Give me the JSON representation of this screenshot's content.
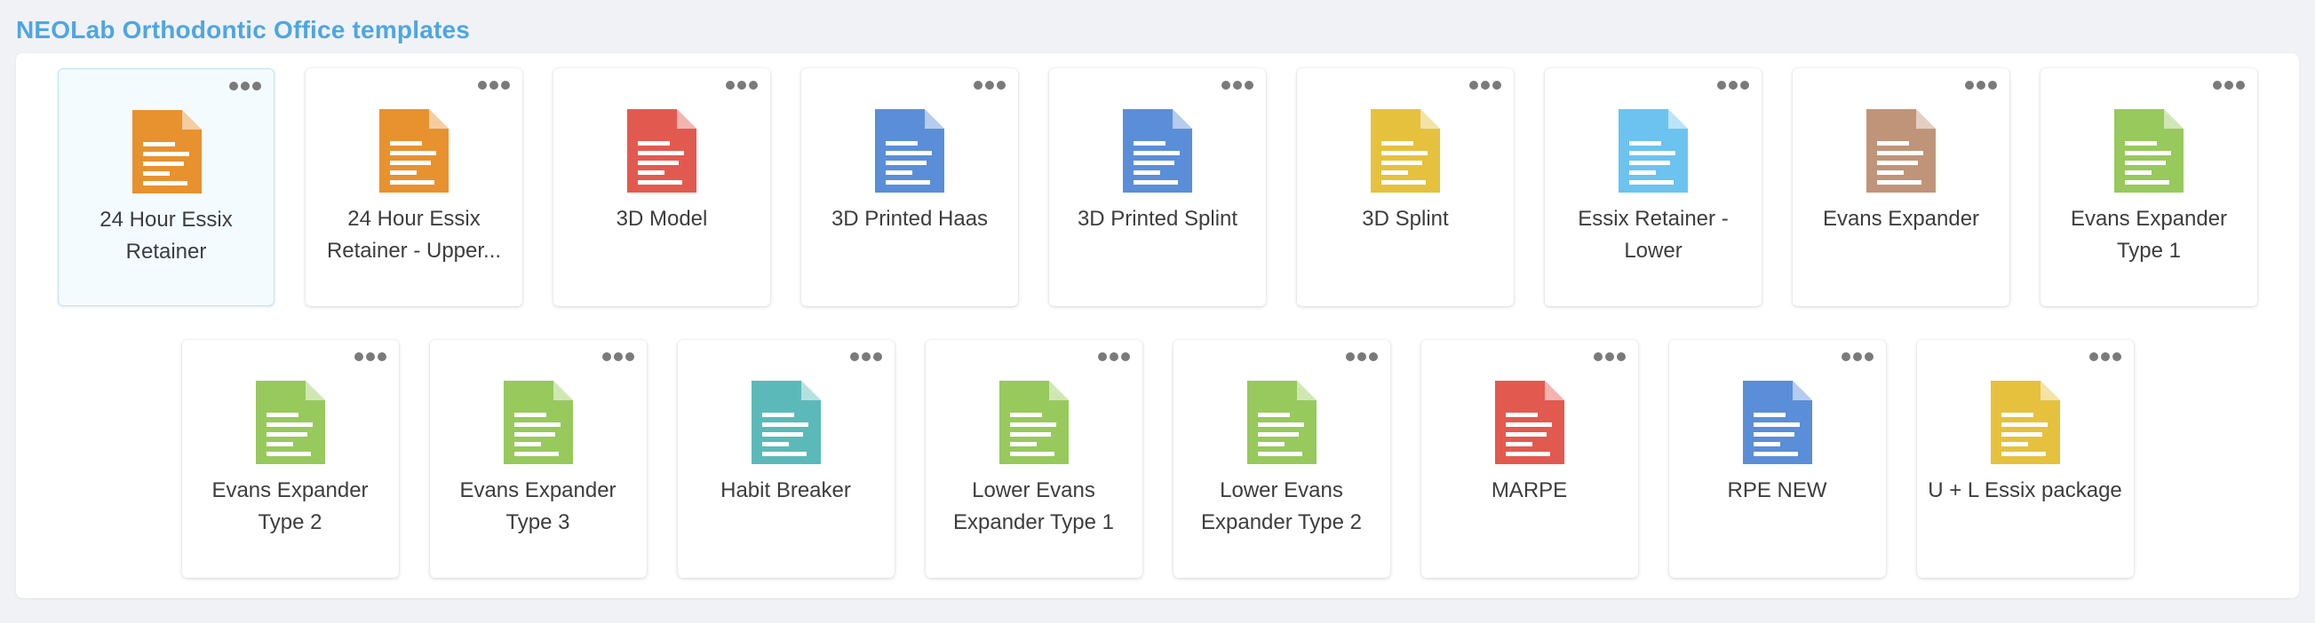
{
  "header": {
    "title": "NEOLab Orthodontic Office templates"
  },
  "colors": {
    "title": "#4da6e3",
    "orange": "#e8912f",
    "red": "#e25a4f",
    "blue": "#5b8ed8",
    "yellow": "#e6c13e",
    "light_blue": "#6cc3ef",
    "brown": "#c09479",
    "green": "#97c95c",
    "teal": "#5bbab9"
  },
  "templates": [
    {
      "label": "24 Hour Essix Retainer",
      "color": "#e8912f",
      "icon": "document-icon",
      "selected": true
    },
    {
      "label": "24 Hour Essix Retainer - Upper...",
      "color": "#e8912f",
      "icon": "document-icon"
    },
    {
      "label": "3D Model",
      "color": "#e25a4f",
      "icon": "document-icon"
    },
    {
      "label": "3D Printed Haas",
      "color": "#5b8ed8",
      "icon": "document-icon"
    },
    {
      "label": "3D Printed Splint",
      "color": "#5b8ed8",
      "icon": "document-icon"
    },
    {
      "label": "3D Splint",
      "color": "#e6c13e",
      "icon": "document-icon"
    },
    {
      "label": "Essix Retainer - Lower",
      "color": "#6cc3ef",
      "icon": "document-icon"
    },
    {
      "label": "Evans Expander",
      "color": "#c09479",
      "icon": "document-icon"
    },
    {
      "label": "Evans Expander Type 1",
      "color": "#97c95c",
      "icon": "document-icon"
    },
    {
      "label": "Evans Expander Type 2",
      "color": "#97c95c",
      "icon": "document-icon"
    },
    {
      "label": "Evans Expander Type 3",
      "color": "#97c95c",
      "icon": "document-icon"
    },
    {
      "label": "Habit Breaker",
      "color": "#5bbab9",
      "icon": "document-icon"
    },
    {
      "label": "Lower Evans Expander Type 1",
      "color": "#97c95c",
      "icon": "document-icon"
    },
    {
      "label": "Lower Evans Expander Type 2",
      "color": "#97c95c",
      "icon": "document-icon"
    },
    {
      "label": "MARPE",
      "color": "#e25a4f",
      "icon": "document-icon"
    },
    {
      "label": "RPE NEW",
      "color": "#5b8ed8",
      "icon": "document-icon"
    },
    {
      "label": "U + L Essix package",
      "color": "#e6c13e",
      "icon": "document-icon"
    }
  ]
}
